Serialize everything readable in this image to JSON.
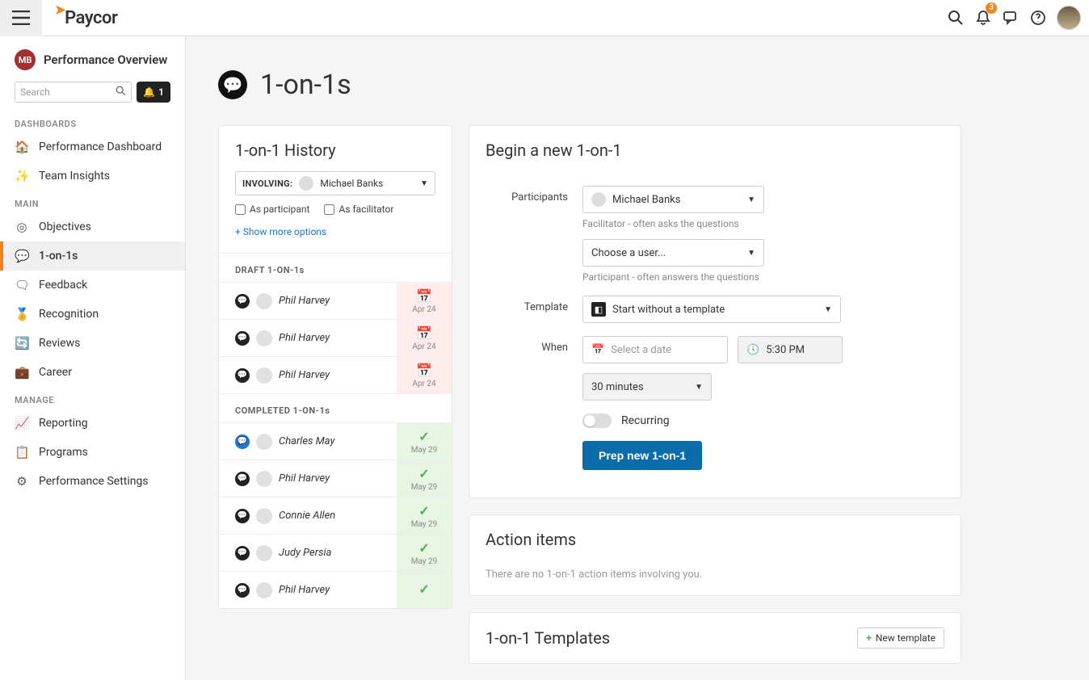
{
  "topbar": {
    "notification_count": "3"
  },
  "user": {
    "initials": "MB",
    "title": "Performance Overview"
  },
  "search": {
    "placeholder": "Search"
  },
  "alert_pill": "1",
  "sections": {
    "dashboards": "DASHBOARDS",
    "main": "MAIN",
    "manage": "MANAGE"
  },
  "nav": {
    "performance_dashboard": "Performance Dashboard",
    "team_insights": "Team Insights",
    "objectives": "Objectives",
    "one_on_ones": "1-on-1s",
    "feedback": "Feedback",
    "recognition": "Recognition",
    "reviews": "Reviews",
    "career": "Career",
    "reporting": "Reporting",
    "programs": "Programs",
    "performance_settings": "Performance Settings"
  },
  "page": {
    "title": "1-on-1s"
  },
  "history": {
    "title": "1-on-1 History",
    "involving_label": "INVOLVING:",
    "involving_user": "Michael Banks",
    "as_participant": "As participant",
    "as_facilitator": "As facilitator",
    "more_options": "Show more options",
    "draft_header": "DRAFT 1-ON-1s",
    "completed_header": "COMPLETED 1-ON-1s",
    "drafts": [
      {
        "name": "Phil Harvey",
        "date": "Apr 24"
      },
      {
        "name": "Phil Harvey",
        "date": "Apr 24"
      },
      {
        "name": "Phil Harvey",
        "date": "Apr 24"
      }
    ],
    "completed": [
      {
        "name": "Charles May",
        "date": "May 29",
        "blue": true
      },
      {
        "name": "Phil Harvey",
        "date": "May 29"
      },
      {
        "name": "Connie Allen",
        "date": "May 29"
      },
      {
        "name": "Judy Persia",
        "date": "May 29"
      },
      {
        "name": "Phil Harvey",
        "date": ""
      }
    ]
  },
  "begin": {
    "title": "Begin a new 1-on-1",
    "participants_label": "Participants",
    "facilitator_value": "Michael Banks",
    "participant_placeholder": "Choose a user...",
    "facilitator_help": "Facilitator - often asks the questions",
    "participant_help": "Participant - often answers the questions",
    "template_label": "Template",
    "template_value": "Start without a template",
    "when_label": "When",
    "date_placeholder": "Select a date",
    "time_value": "5:30 PM",
    "duration_value": "30 minutes",
    "recurring_label": "Recurring",
    "submit_label": "Prep new 1-on-1"
  },
  "action_items": {
    "title": "Action items",
    "empty": "There are no 1-on-1 action items involving you."
  },
  "templates": {
    "title": "1-on-1 Templates",
    "new_button": "New template"
  }
}
